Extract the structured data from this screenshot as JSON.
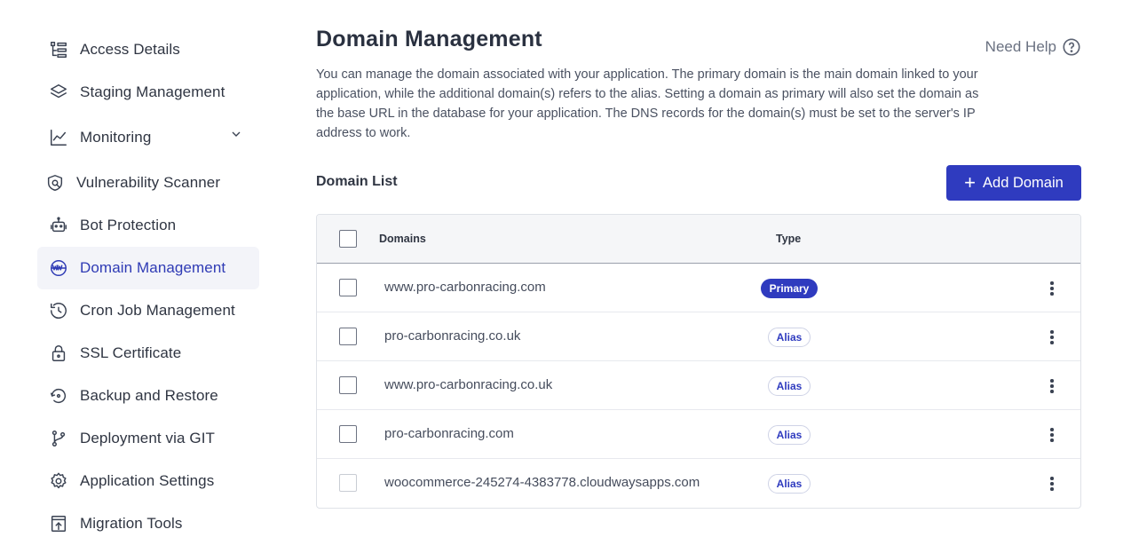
{
  "sidebar": {
    "items": [
      {
        "label": "Access Details",
        "icon": "access-details-icon"
      },
      {
        "label": "Staging Management",
        "icon": "layers-icon"
      },
      {
        "label": "Monitoring",
        "icon": "line-chart-icon"
      },
      {
        "label": "Vulnerability Scanner",
        "icon": "shield-scan-icon"
      },
      {
        "label": "Bot Protection",
        "icon": "robot-icon"
      },
      {
        "label": "Domain Management",
        "icon": "www-globe-icon"
      },
      {
        "label": "Cron Job Management",
        "icon": "history-clock-icon"
      },
      {
        "label": "SSL Certificate",
        "icon": "lock-icon"
      },
      {
        "label": "Backup and Restore",
        "icon": "backup-restore-icon"
      },
      {
        "label": "Deployment via GIT",
        "icon": "git-branch-icon"
      },
      {
        "label": "Application Settings",
        "icon": "gear-icon"
      },
      {
        "label": "Migration Tools",
        "icon": "migration-icon"
      }
    ],
    "active": "Domain Management"
  },
  "header": {
    "title": "Domain Management",
    "help_label": "Need Help",
    "description": "You can manage the domain associated with your application. The primary domain is the main domain linked to your application, while the additional domain(s) refers to the alias. Setting a domain as primary will also set the domain as the base URL in the database for your application. The DNS records for the domain(s) must be set to the server's IP address to work."
  },
  "domain_list": {
    "title": "Domain List",
    "add_button": "Add Domain",
    "columns": {
      "domains": "Domains",
      "type": "Type"
    },
    "rows": [
      {
        "domain": "www.pro-carbonracing.com",
        "type": "Primary"
      },
      {
        "domain": "pro-carbonracing.co.uk",
        "type": "Alias"
      },
      {
        "domain": "www.pro-carbonracing.co.uk",
        "type": "Alias"
      },
      {
        "domain": "pro-carbonracing.com",
        "type": "Alias"
      },
      {
        "domain": "woocommerce-245274-4383778.cloudwaysapps.com",
        "type": "Alias"
      }
    ]
  },
  "colors": {
    "accent": "#2f3bbf",
    "active_bg": "#f3f4f9"
  }
}
